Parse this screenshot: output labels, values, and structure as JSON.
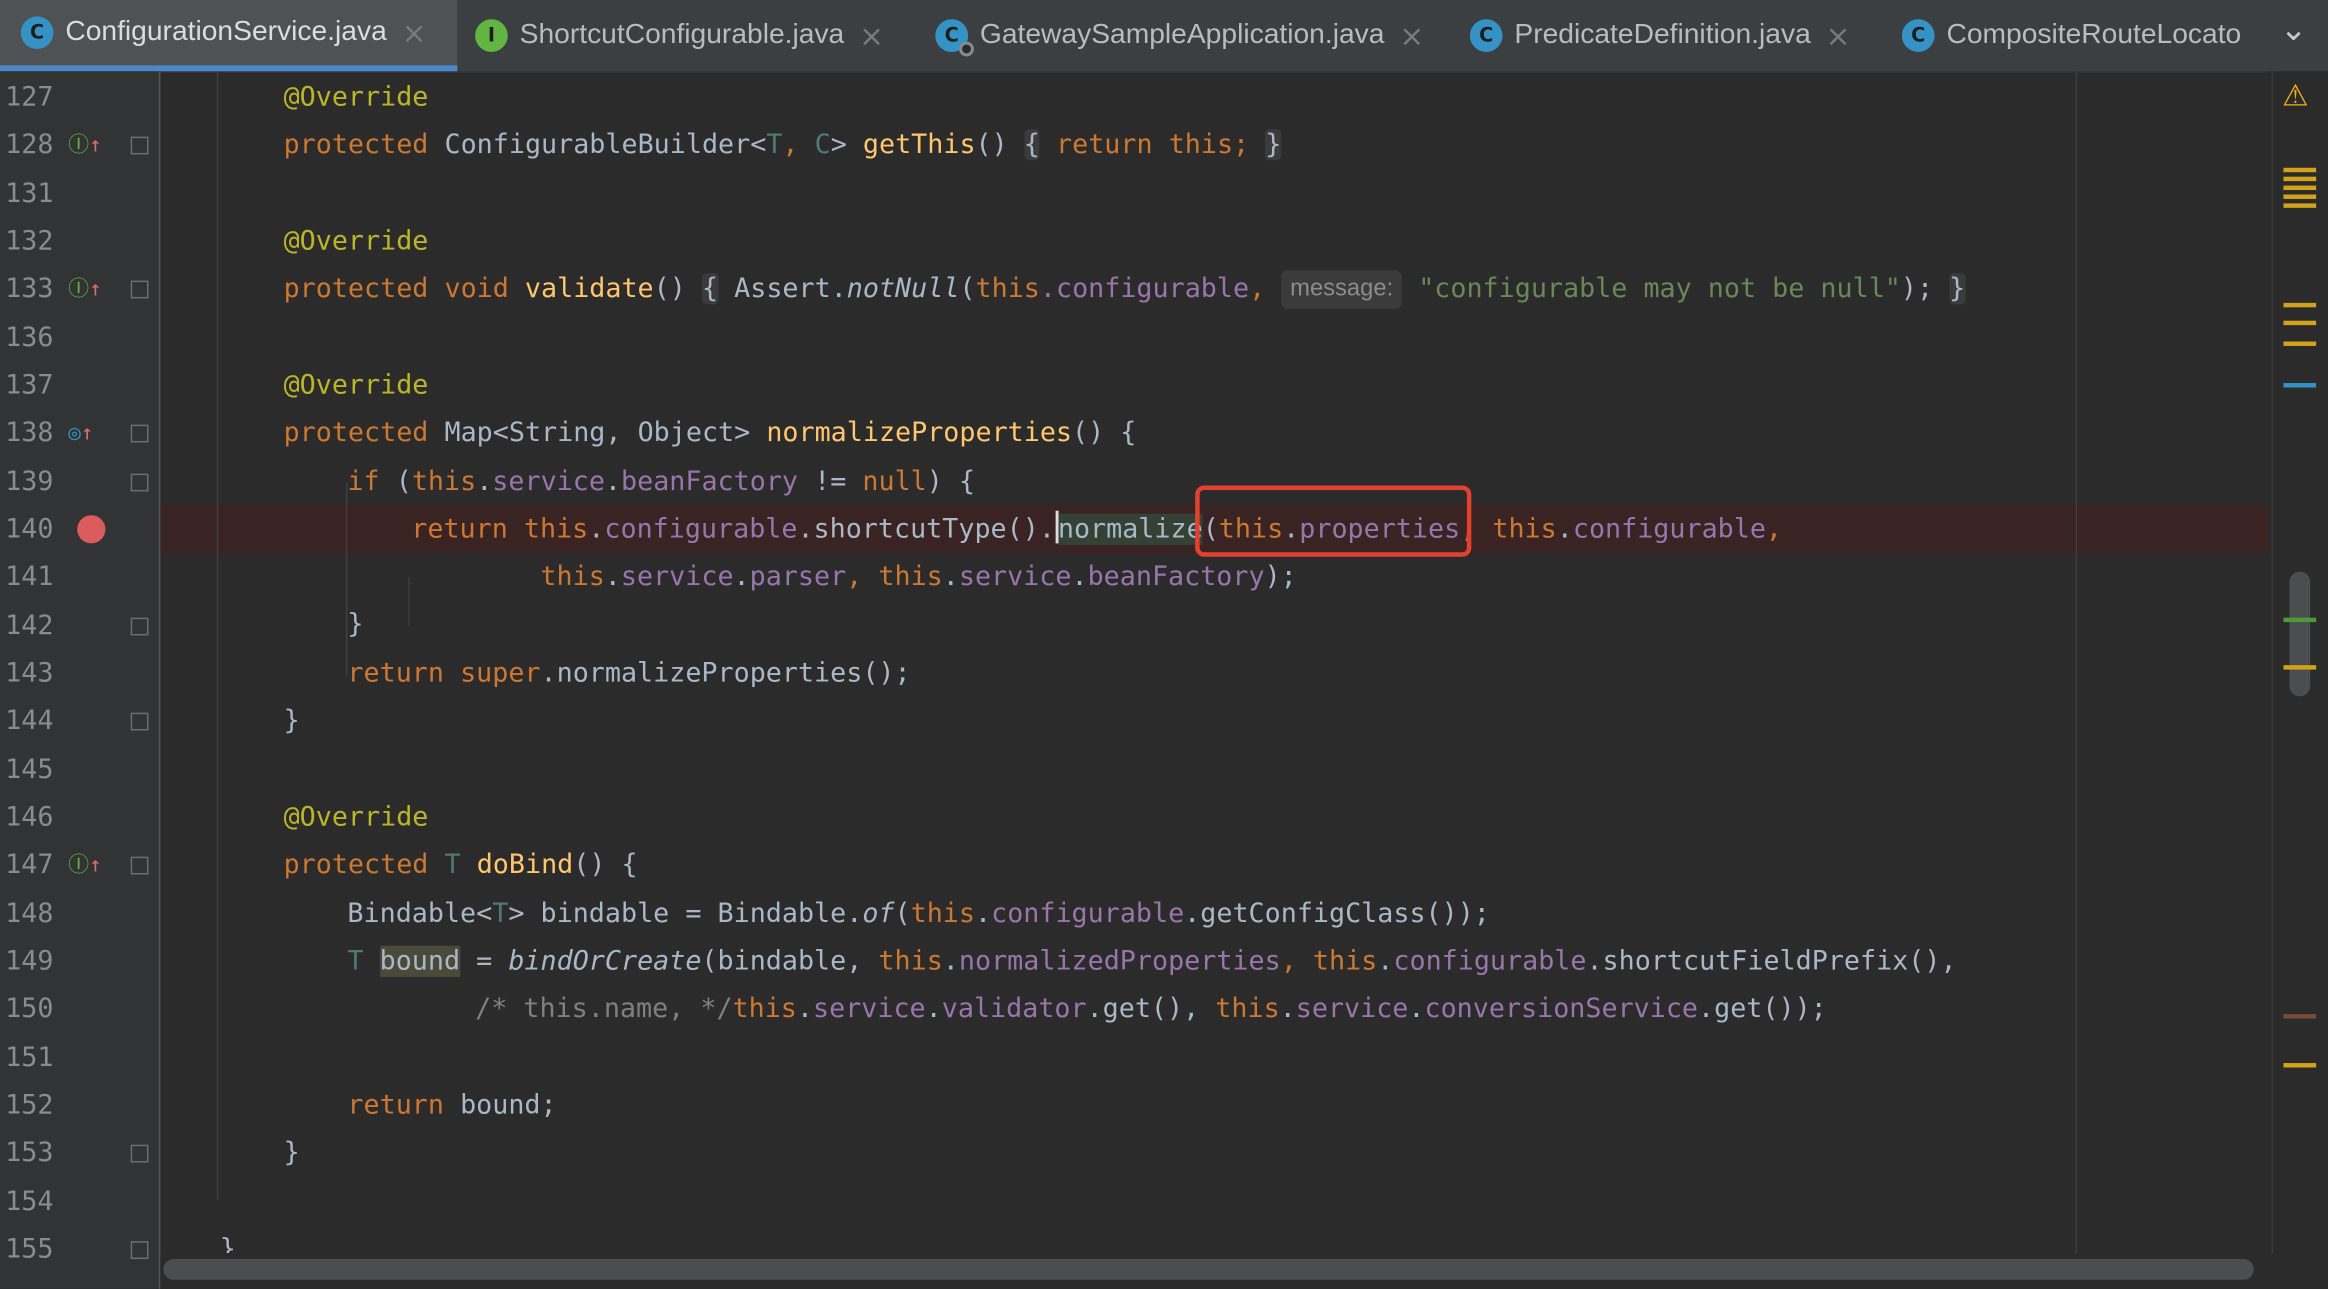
{
  "tabs": [
    {
      "label": "ConfigurationService.java",
      "icon": "C",
      "kind": "class",
      "active": true
    },
    {
      "label": "ShortcutConfigurable.java",
      "icon": "I",
      "kind": "interface",
      "active": false
    },
    {
      "label": "GatewaySampleApplication.java",
      "icon": "C",
      "kind": "spring-class",
      "active": false
    },
    {
      "label": "PredicateDefinition.java",
      "icon": "C",
      "kind": "class",
      "active": false
    },
    {
      "label": "CompositeRouteLocato",
      "icon": "C",
      "kind": "class",
      "active": false
    }
  ],
  "close_glyph": "×",
  "more_glyph": "⌄",
  "line_numbers": [
    "127",
    "128",
    "131",
    "132",
    "133",
    "136",
    "137",
    "138",
    "139",
    "140",
    "141",
    "142",
    "143",
    "144",
    "145",
    "146",
    "147",
    "148",
    "149",
    "150",
    "151",
    "152",
    "153",
    "154",
    "155"
  ],
  "breakpoint_line": "140",
  "inlay_hint": "message:",
  "code": {
    "annotation": "@Override",
    "l128": {
      "kw": "protected",
      "type": "ConfigurableBuilder<",
      "t": "T",
      ", ": ", ",
      "c": "C",
      "close": ">",
      "fn": "getThis",
      "parens": "()",
      "lb": "{",
      "ret": "return",
      "this": "this;",
      "rb": "}"
    },
    "l133": {
      "kw": "protected void",
      "fn": "validate",
      "parens": "()",
      "lb": "{",
      "cls": "Assert.",
      "call": "notNull",
      "open": "(",
      "this": "this",
      "field": ".configurable",
      "comma": ",",
      "str": "\"configurable may not be null\"",
      "end": ");",
      "rb": "}"
    },
    "l138": {
      "kw": "protected",
      "type": "Map<String, Object>",
      "fn": "normalizeProperties",
      "rest": "() {"
    },
    "l139": {
      "kw": "if",
      "open": " (",
      "this": "this",
      "f1": "service",
      "f2": "beanFactory",
      "op": " != ",
      "null": "null",
      "rest": ") {"
    },
    "l140": {
      "kw": "return",
      "this1": "this",
      "f1": "configurable",
      "call": ".shortcutType().",
      "norm": "normalize",
      "open": "(",
      "this2": "this",
      "f2": "properties",
      "comma": ",",
      "this3": "this",
      "f3": "configurable",
      "comma2": ","
    },
    "l141": {
      "this1": "this",
      "f1": "service",
      "f2": "parser",
      "this2": "this",
      "f3": "service",
      "f4": "beanFactory",
      "end": ");"
    },
    "l142": "}",
    "l143": {
      "kw": "return",
      "sup": "super",
      "rest": ".normalizeProperties();"
    },
    "l144": "}",
    "l147": {
      "kw": "protected",
      "t": "T",
      "fn": "doBind",
      "rest": "() {"
    },
    "l148": {
      "type": "Bindable<",
      "t": "T",
      "rest1": "> bindable = Bindable.",
      "of": "of",
      "open": "(",
      "this": "this",
      "f1": "configurable",
      "rest2": ".getConfigClass());"
    },
    "l149": {
      "t": "T",
      "bound": "bound",
      "eq": " = ",
      "call": "bindOrCreate",
      "a1": "(bindable, ",
      "this1": "this",
      "f1": "normalizedProperties",
      "this2": "this",
      "f2": "configurable",
      "rest": ".shortcutFieldPrefix(),"
    },
    "l150": {
      "cm": "/* this.name, */",
      "this1": "this",
      "f1": "service",
      "f2": "validator",
      "r1": ".get(), ",
      "this2": "this",
      "f3": "service",
      "f4": "conversionService",
      "r2": ".get());"
    },
    "l152": {
      "kw": "return",
      "rest": "bound;"
    },
    "l153": "}",
    "l155": "}"
  },
  "colors": {
    "keyword": "#cc7832",
    "annotation": "#bbb529",
    "method": "#ffc66d",
    "field": "#9876aa",
    "string": "#6a8759",
    "highlight_box": "#e4402f",
    "breakpoint": "#db5c5c"
  }
}
